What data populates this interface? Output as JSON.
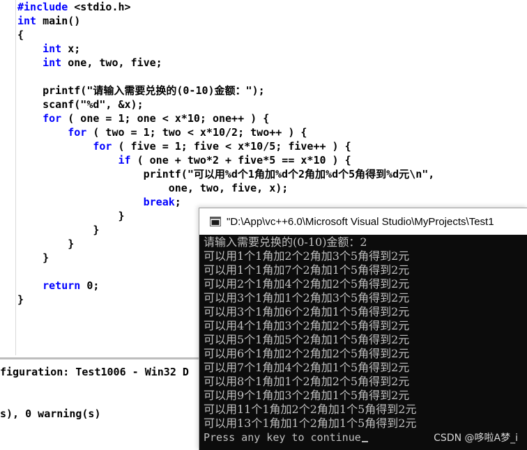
{
  "editor": {
    "lines": [
      {
        "kw": "#include",
        "rest": " <stdio.h>"
      },
      {
        "kw": "int",
        "rest": " main()"
      },
      {
        "kw": "",
        "rest": "{"
      },
      {
        "kw": "",
        "rest": "    ",
        "kw2": "int",
        "rest2": " x;"
      },
      {
        "kw": "",
        "rest": "    ",
        "kw2": "int",
        "rest2": " one, two, five;"
      },
      {
        "kw": "",
        "rest": ""
      },
      {
        "kw": "",
        "rest": "    printf(\"请输入需要兑换的(0-10)金额：\");"
      },
      {
        "kw": "",
        "rest": "    scanf(\"%d\", &x);"
      },
      {
        "kw": "",
        "rest": "    ",
        "kw2": "for",
        "rest2": " ( one = 1; one < x*10; one++ ) {"
      },
      {
        "kw": "",
        "rest": "        ",
        "kw2": "for",
        "rest2": " ( two = 1; two < x*10/2; two++ ) {"
      },
      {
        "kw": "",
        "rest": "            ",
        "kw2": "for",
        "rest2": " ( five = 1; five < x*10/5; five++ ) {"
      },
      {
        "kw": "",
        "rest": "                ",
        "kw2": "if",
        "rest2": " ( one + two*2 + five*5 == x*10 ) {"
      },
      {
        "kw": "",
        "rest": "                    printf(\"可以用%d个1角加%d个2角加%d个5角得到%d元\\n\","
      },
      {
        "kw": "",
        "rest": "                        one, two, five, x);"
      },
      {
        "kw": "",
        "rest": "                    ",
        "kw2": "break",
        "rest2": ";"
      },
      {
        "kw": "",
        "rest": "                }"
      },
      {
        "kw": "",
        "rest": "            }"
      },
      {
        "kw": "",
        "rest": "        }"
      },
      {
        "kw": "",
        "rest": "    }"
      },
      {
        "kw": "",
        "rest": ""
      },
      {
        "kw": "",
        "rest": "    ",
        "kw2": "return",
        "rest2": " 0;"
      },
      {
        "kw": "",
        "rest": "}"
      }
    ]
  },
  "output_panel": {
    "line1": "figuration: Test1006 - Win32 D",
    "line2": "s), 0 warning(s)"
  },
  "console": {
    "title": "\"D:\\App\\vc++6.0\\Microsoft Visual Studio\\MyProjects\\Test1",
    "lines": [
      "请输入需要兑换的(0-10)金额：2",
      "可以用1个1角加2个2角加3个5角得到2元",
      "可以用1个1角加7个2角加1个5角得到2元",
      "可以用2个1角加4个2角加2个5角得到2元",
      "可以用3个1角加1个2角加3个5角得到2元",
      "可以用3个1角加6个2角加1个5角得到2元",
      "可以用4个1角加3个2角加2个5角得到2元",
      "可以用5个1角加5个2角加1个5角得到2元",
      "可以用6个1角加2个2角加2个5角得到2元",
      "可以用7个1角加4个2角加1个5角得到2元",
      "可以用8个1角加1个2角加2个5角得到2元",
      "可以用9个1角加3个2角加1个5角得到2元",
      "可以用11个1角加2个2角加1个5角得到2元",
      "可以用13个1角加1个2角加1个5角得到2元"
    ],
    "prompt": "Press any key to continue",
    "watermark": "CSDN @哆啦A梦_i",
    "icon": "console-window-icon"
  },
  "colors": {
    "keyword": "#0000ff",
    "console_bg": "#0c0c0c",
    "console_text": "#c0c0c0"
  }
}
